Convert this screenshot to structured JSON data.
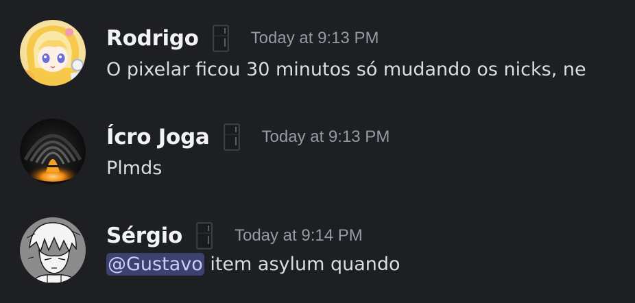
{
  "messages": [
    {
      "username": "Rodrigo",
      "badge_icon": "fridge-badge-icon",
      "timestamp": "Today at 9:13 PM",
      "avatar": "anime-girl-yellow-hood-avatar",
      "text": "O pixelar ficou 30 minutos só mudando os nicks, ne"
    },
    {
      "username": "Ícro Joga",
      "badge_icon": "fridge-badge-icon",
      "timestamp": "Today at 9:13 PM",
      "avatar": "dark-glowing-orb-avatar",
      "text": "Plmds"
    },
    {
      "username": "Sérgio",
      "badge_icon": "fridge-badge-icon",
      "timestamp": "Today at 9:14 PM",
      "avatar": "sketch-character-avatar",
      "mention": "@Gustavo",
      "text": " item asylum quando"
    }
  ],
  "colors": {
    "background": "#1e1f23",
    "username": "#f2f3f5",
    "timestamp": "#949ba4",
    "text": "#dbdee1",
    "mention_bg": "#3c4270",
    "mention_text": "#c9cdfb"
  }
}
